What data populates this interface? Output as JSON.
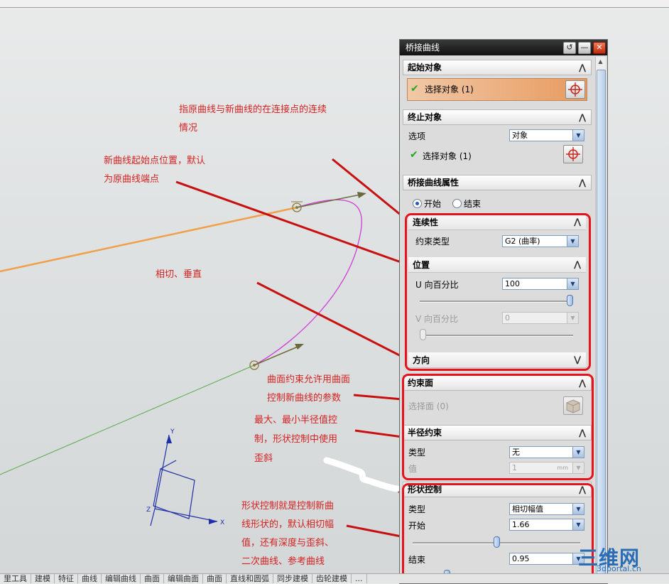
{
  "dialog": {
    "title": "桥接曲线",
    "title_buttons": [
      "↺",
      "—",
      "✕"
    ],
    "start_object": {
      "header": "起始对象",
      "select_label": "选择对象 (1)"
    },
    "end_object": {
      "header": "终止对象",
      "option_label": "选项",
      "option_value": "对象",
      "select_label": "选择对象 (1)"
    },
    "properties": {
      "header": "桥接曲线属性",
      "radio_start": "开始",
      "radio_end": "结束",
      "continuity": {
        "header": "连续性",
        "constraint_label": "约束类型",
        "constraint_value": "G2 (曲率)"
      },
      "position": {
        "header": "位置",
        "u_label": "U 向百分比",
        "u_value": "100",
        "u_slider_fraction": 1.0,
        "v_label": "V 向百分比",
        "v_value": "0",
        "v_slider_fraction": 0.0
      },
      "direction": {
        "header": "方向"
      }
    },
    "constraint_face": {
      "header": "约束面",
      "select_label": "选择面 (0)"
    },
    "radius_constraint": {
      "header": "半径约束",
      "type_label": "类型",
      "type_value": "无",
      "value_label": "值",
      "value_value": "1",
      "value_unit": "mm"
    },
    "shape_control": {
      "header": "形状控制",
      "type_label": "类型",
      "type_value": "相切幅值",
      "start_label": "开始",
      "start_value": "1.66",
      "start_slider_fraction": 0.5,
      "end_label": "结束",
      "end_value": "0.95"
    }
  },
  "annotations": {
    "continuity": "指原曲线与新曲线的在连接点的连续\n情况",
    "start_point": "新曲线起始点位置，默认\n为原曲线端点",
    "tangent": "相切、垂直",
    "constraint_face": "曲面约束允许用曲面\n控制新曲线的参数",
    "radius": "最大、最小半径值控\n制，形状控制中使用\n歪斜",
    "shape": "形状控制就是控制新曲\n线形状的，默认相切幅\n值，还有深度与歪斜、\n二次曲线、参考曲线"
  },
  "axes": {
    "x": "X",
    "y": "Y",
    "z": "Z"
  },
  "statusbar": [
    "里工具",
    "建模",
    "特征",
    "曲线",
    "编辑曲线",
    "曲面",
    "编辑曲面",
    "曲面",
    "直线和圆弧",
    "同步建模",
    "齿轮建模",
    "..."
  ],
  "watermark": {
    "text": "三维网",
    "url": "3dportal.cn"
  },
  "colors": {
    "annotation_red": "#d62222",
    "highlight_red": "#e8121c",
    "orange_curve": "#f0a04a",
    "bridge_curve": "#d13ad8",
    "green_curve": "#58a84a",
    "vector": "#6b6a3c",
    "axis_blue": "#1f2fa8",
    "watermark_blue": "#2a6db5"
  }
}
